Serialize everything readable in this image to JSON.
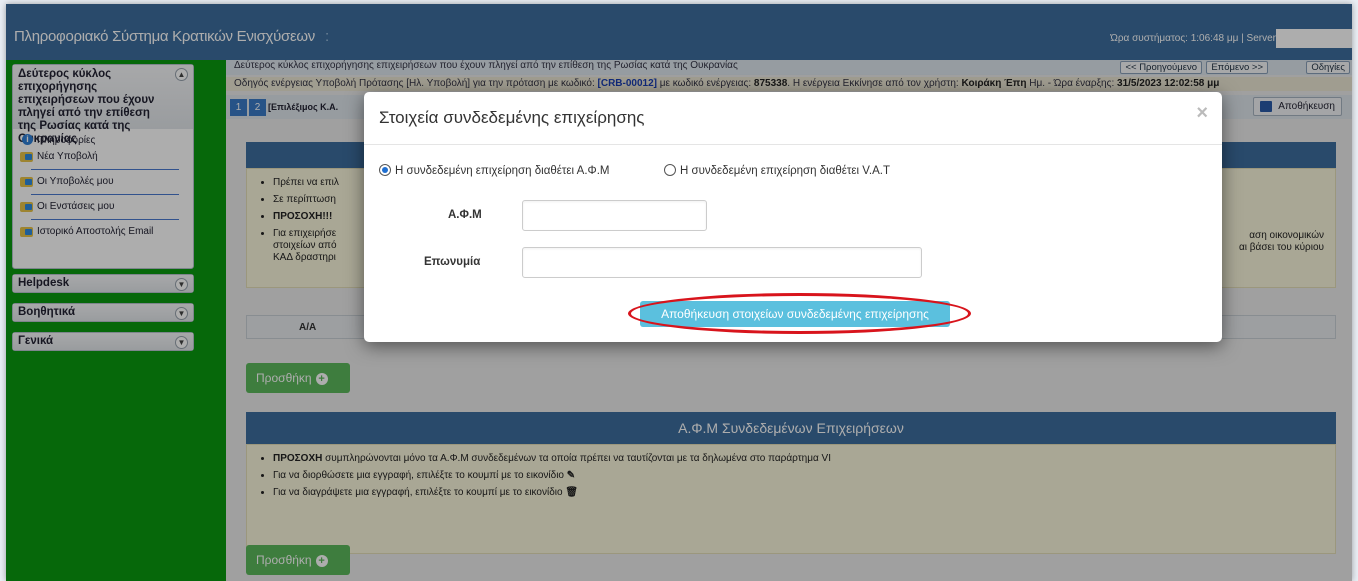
{
  "app": {
    "title": "Πληροφοριακό Σύστημα Κρατικών Ενισχύσεων",
    "title_sep": ":",
    "system_time": "Ώρα συστήματος: 1:06:48 μμ | Server"
  },
  "sidebar": {
    "section_main": "Δεύτερος κύκλος επιχορήγησης επιχειρήσεων που έχουν πληγεί από την επίθεση της Ρωσίας κατά της Ουκρανίας",
    "items": [
      {
        "label": "Πληροφορίες",
        "icon": "info-icon"
      },
      {
        "label": "Νέα Υποβολή",
        "icon": "folder-icon"
      },
      {
        "label": "Οι Υποβολές μου",
        "icon": "folder-icon"
      },
      {
        "label": "Οι Ενστάσεις μου",
        "icon": "folder-icon"
      },
      {
        "label": "Ιστορικό Αποστολής Email",
        "icon": "folder-icon"
      }
    ],
    "section_helpdesk": "Helpdesk",
    "section_tools": "Βοηθητικά",
    "section_general": "Γενικά"
  },
  "content": {
    "subbar1": "Δεύτερος κύκλος επιχορήγησης επιχειρήσεων που έχουν πληγεί από την επίθεση της Ρωσίας κατά της Ουκρανίας",
    "prev_label": "<< Προηγούμενο",
    "next_label": "Επόμενο >>",
    "help_label": "Οδηγίες",
    "subbar2_prefix": "Οδηγός ενέργειας Υποβολή Πρότασης [Ηλ. Υποβολή] για την πρόταση με κωδικό:",
    "subbar2_code": "[CRB-00012]",
    "subbar2_mid": "με κωδικό ενέργειας:",
    "subbar2_energy": "875338",
    "subbar2_rest": ". Η ενέργεια Εκκίνησε από τον χρήστη:",
    "subbar2_user": "Κοιράκη Έπη",
    "subbar2_tail": "Ημ. - Ώρα έναρξης:",
    "subbar2_date": "31/5/2023 12:02:58 μμ",
    "step1": "1",
    "step2": "2",
    "tab_title": "[Επιλέξιμος Κ.Α.",
    "save_top": "Αποθήκευση",
    "p1_bullets": [
      "Πρέπει να επιλ",
      "Σε περίπτωση",
      "ΠΡΟΣΟΧΗ!!!",
      "Για επιχειρήσε"
    ],
    "p1_bullet4_line2": "στοιχείων από",
    "p1_bullet4_line3": "ΚΑΔ δραστηρι",
    "p1_right1": "αση οικονομικών",
    "p1_right2": "αι βάσει του κύριου",
    "table_col_aa": "Α/Α",
    "add_label": "Προσθήκη",
    "p2_title": "Α.Φ.Μ Συνδεδεμένων Επιχειρήσεων",
    "p2_b1_strong": "ΠΡΟΣΟΧΗ",
    "p2_b1": "συμπληρώνονται μόνο τα Α.Φ.Μ συνδεδεμένων τα οποία πρέπει να ταυτίζονται με τα δηλωμένα στο παράρτημα VI",
    "p2_b2": "Για να διορθώσετε μια εγγραφή, επιλέξτε το κουμπί με το εικονίδιο",
    "p2_b3": "Για να διαγράψετε μια εγγραφή, επιλέξτε το κουμπί με το εικονίδιο"
  },
  "modal": {
    "title": "Στοιχεία συνδεδεμένης επιχείρησης",
    "close": "×",
    "radio_afm": "Η συνδεδεμένη επιχείρηση διαθέτει Α.Φ.Μ",
    "radio_vat": "Η συνδεδεμένη επιχείρηση διαθέτει V.A.T",
    "label_afm": "Α.Φ.Μ",
    "label_name": "Επωνυμία",
    "afm_value": "",
    "name_value": "",
    "save_label": "Αποθήκευση στοιχείων συνδεδεμένης επιχείρησης"
  }
}
